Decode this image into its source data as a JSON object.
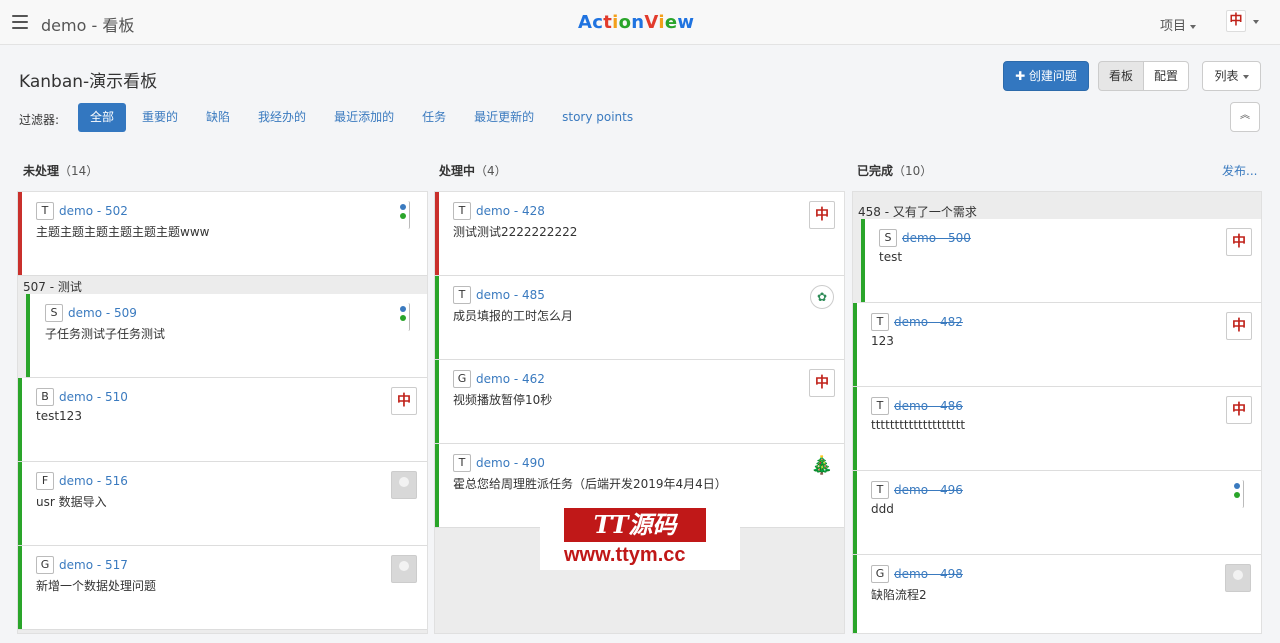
{
  "app": {
    "project_title": "demo - 看板",
    "brand": [
      "A",
      "c",
      "t",
      "i",
      "o",
      "n",
      "V",
      "i",
      "e",
      "w"
    ],
    "brand_colors": [
      "#1f73e0",
      "#1f73e0",
      "#e23b2c",
      "#f3a01b",
      "#2aa52a",
      "#1f73e0",
      "#e23b2c",
      "#f3a01b",
      "#2aa52a",
      "#1f73e0"
    ],
    "projects_label": "项目",
    "avatar_glyph": "中"
  },
  "header": {
    "title": "Kanban-演示看板",
    "create_label": "✚ 创建问题",
    "view_board": "看板",
    "view_config": "配置",
    "list_label": "列表"
  },
  "filters": {
    "label": "过滤器:",
    "items": [
      "全部",
      "重要的",
      "缺陷",
      "我经办的",
      "最近添加的",
      "任务",
      "最近更新的",
      "story points"
    ],
    "collapse_icon": "≈"
  },
  "columns": [
    {
      "title": "未处理",
      "count": "（14）"
    },
    {
      "title": "处理中",
      "count": "（4）"
    },
    {
      "title": "已完成",
      "count": "（10）",
      "release": "发布..."
    }
  ],
  "col1": {
    "cards": [
      {
        "type": "T",
        "key": "demo - 502",
        "summary": "主题主题主题主题主题主题www",
        "bar": "red",
        "avatar": "dots"
      },
      {
        "type": "S",
        "key": "demo - 509",
        "summary": "子任务测试子任务测试",
        "bar": "green",
        "avatar": "dots"
      },
      {
        "type": "B",
        "key": "demo - 510",
        "summary": "test123",
        "bar": "green",
        "avatar": "中"
      },
      {
        "type": "F",
        "key": "demo - 516",
        "summary": "usr 数据导入",
        "bar": "green",
        "avatar": "grey"
      },
      {
        "type": "G",
        "key": "demo - 517",
        "summary": "新增一个数据处理问题",
        "bar": "green",
        "avatar": "grey"
      }
    ],
    "group": "507 - 测试"
  },
  "col2": {
    "cards": [
      {
        "type": "T",
        "key": "demo - 428",
        "summary": "测试测试2222222222",
        "bar": "red",
        "avatar": "中"
      },
      {
        "type": "T",
        "key": "demo - 485",
        "summary": "成员填报的工时怎么月",
        "bar": "green",
        "avatar": "✿"
      },
      {
        "type": "G",
        "key": "demo - 462",
        "summary": "视频播放暂停10秒",
        "bar": "green",
        "avatar": "中"
      },
      {
        "type": "T",
        "key": "demo - 490",
        "summary": "霍总您给周理胜派任务（后端开发2019年4月4日）",
        "bar": "green",
        "avatar": "🎄"
      }
    ]
  },
  "col3": {
    "group": "458 - 又有了一个需求",
    "cards": [
      {
        "type": "S",
        "key": "demo - 500",
        "summary": "test",
        "bar": "green",
        "avatar": "中"
      },
      {
        "type": "T",
        "key": "demo - 482",
        "summary": "123",
        "bar": "green",
        "avatar": "中"
      },
      {
        "type": "T",
        "key": "demo - 486",
        "summary": "tttttttttttttttttttt",
        "bar": "green",
        "avatar": "中"
      },
      {
        "type": "T",
        "key": "demo - 496",
        "summary": "ddd",
        "bar": "green",
        "avatar": "dots"
      },
      {
        "type": "G",
        "key": "demo - 498",
        "summary": "缺陷流程2",
        "bar": "green",
        "avatar": "grey"
      }
    ]
  },
  "watermark": {
    "top": "TT源码",
    "bottom": "www.ttym.cc"
  }
}
